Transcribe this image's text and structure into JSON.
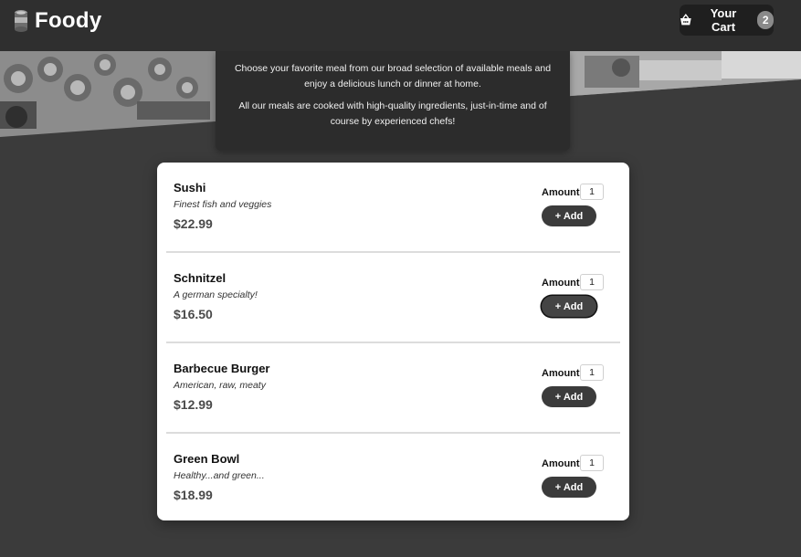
{
  "header": {
    "logo_text": "Foody",
    "logo_icon": "can-icon",
    "cart": {
      "label": "Your Cart",
      "count": "2",
      "icon": "basket-icon"
    }
  },
  "intro": {
    "paragraph1": "Choose your favorite meal from our broad selection of available meals and enjoy a delicious lunch or dinner at home.",
    "paragraph2": "All our meals are cooked with high-quality ingredients, just-in-time and of course by experienced chefs!"
  },
  "meals": {
    "amount_label": "Amount",
    "add_label": "+ Add",
    "items": [
      {
        "name": "Sushi",
        "description": "Finest fish and veggies",
        "price": "$22.99",
        "amount": "1"
      },
      {
        "name": "Schnitzel",
        "description": "A german specialty!",
        "price": "$16.50",
        "amount": "1"
      },
      {
        "name": "Barbecue Burger",
        "description": "American, raw, meaty",
        "price": "$12.99",
        "amount": "1"
      },
      {
        "name": "Green Bowl",
        "description": "Healthy...and green...",
        "price": "$18.99",
        "amount": "1"
      }
    ]
  },
  "colors": {
    "background": "#3b3b3b",
    "header": "#2f2f2f",
    "card": "#ffffff",
    "button": "#3b3b3b"
  }
}
